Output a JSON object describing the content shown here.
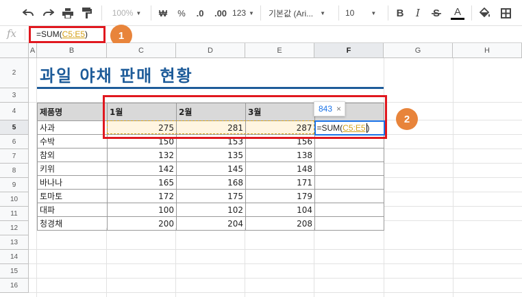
{
  "toolbar": {
    "zoom": "100%",
    "currency": "₩",
    "percent": "%",
    "dec_decrease": ".0",
    "dec_increase": ".00",
    "number_format": "123",
    "font": "기본값 (Ari...",
    "font_size": "10",
    "bold": "B",
    "italic": "I",
    "text_color": "A"
  },
  "formula_bar": {
    "fx_label": "fx",
    "prefix": "=SUM(",
    "ref": "C5:E5",
    "suffix": ")"
  },
  "callouts": [
    "1",
    "2"
  ],
  "columns": [
    "A",
    "B",
    "C",
    "D",
    "E",
    "F",
    "G",
    "H"
  ],
  "rows": [
    "2",
    "3",
    "4",
    "5",
    "6",
    "7",
    "8",
    "9",
    "10",
    "11",
    "12",
    "13",
    "14",
    "15",
    "16"
  ],
  "sheet": {
    "title": "과일 야채 판매 현황",
    "headers": [
      "제품명",
      "1월",
      "2월",
      "3월",
      ""
    ],
    "data": [
      [
        "사과",
        "275",
        "281",
        "287"
      ],
      [
        "수박",
        "150",
        "153",
        "156"
      ],
      [
        "참외",
        "132",
        "135",
        "138"
      ],
      [
        "키위",
        "142",
        "145",
        "148"
      ],
      [
        "바나나",
        "165",
        "168",
        "171"
      ],
      [
        "토마토",
        "172",
        "175",
        "179"
      ],
      [
        "대파",
        "100",
        "102",
        "104"
      ],
      [
        "청경채",
        "200",
        "204",
        "208"
      ]
    ],
    "active_cell": {
      "prefix": "=SUM(",
      "ref": "C5:E5",
      "suffix": ")"
    }
  },
  "tooltip": {
    "value": "843",
    "close": "×"
  },
  "colors": {
    "title": "#1d5b99",
    "highlight": "#e0171e",
    "callout": "#e8843b",
    "ref": "#d4a017"
  }
}
